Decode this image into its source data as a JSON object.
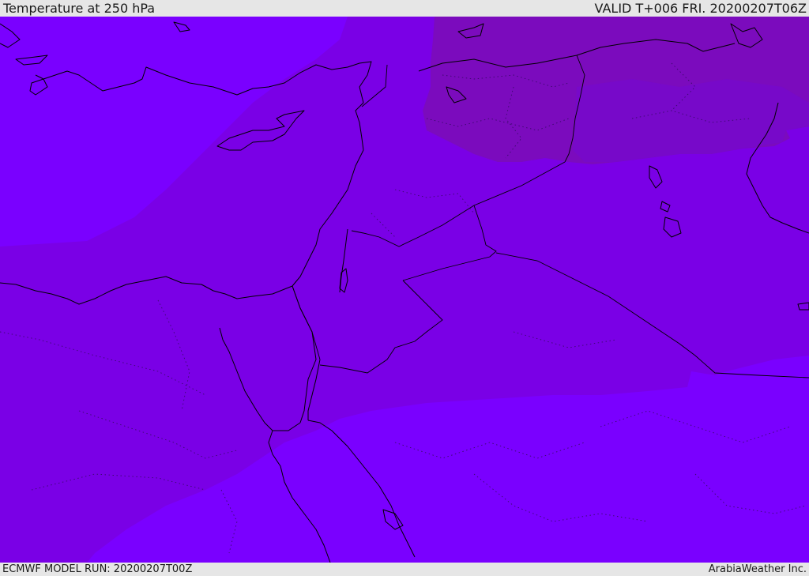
{
  "header": {
    "title": "Temperature at 250 hPa",
    "valid": "VALID T+006 FRI. 20200207T06Z"
  },
  "footer": {
    "model_run": "ECMWF MODEL RUN: 20200207T00Z",
    "brand": "ArabiaWeather Inc."
  },
  "map": {
    "colors": {
      "cold_band": "#7b0bbd",
      "mid_band": "#7a00e6",
      "warm_band": "#7a00ff",
      "coastline": "#000000"
    }
  }
}
